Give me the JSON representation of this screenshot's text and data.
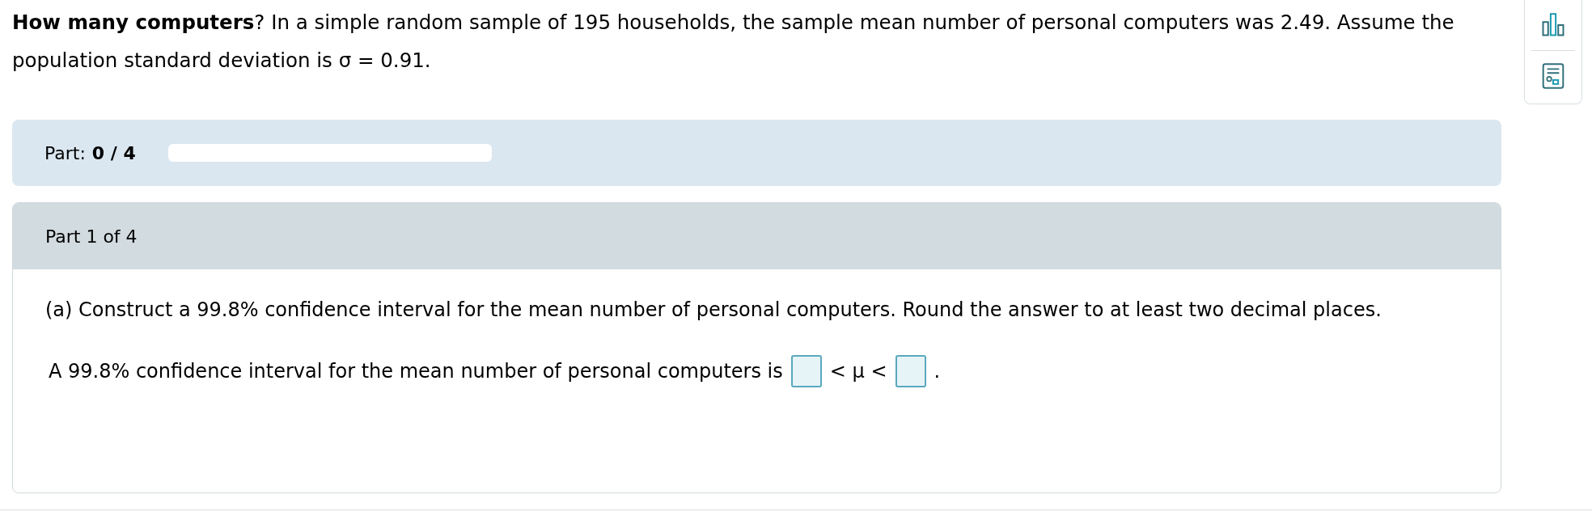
{
  "question": "**How many computers**? In a simple random sample of 195 households, the sample mean number of personal computers was 2.49. Assume the population standard deviation is σ = 0.91.",
  "tools": [
    {
      "kind": "chart"
    },
    {
      "kind": "reference"
    }
  ],
  "progress": {
    "label": "Part:",
    "value": "0 / 4",
    "level": 0
  },
  "part": {
    "title": "Part 1 of 4",
    "instruction": "(a) Construct a 99.8% confidence interval for the mean number of personal computers. Round the answer to at least two decimal places.",
    "answer": [
      {
        "kind": "text",
        "text": "A 99.8% confidence interval for the mean number of personal computers is"
      },
      {
        "kind": "blank"
      },
      {
        "kind": "text",
        "text": "< μ <"
      },
      {
        "kind": "blank"
      },
      {
        "kind": "text",
        "text": "."
      }
    ]
  }
}
